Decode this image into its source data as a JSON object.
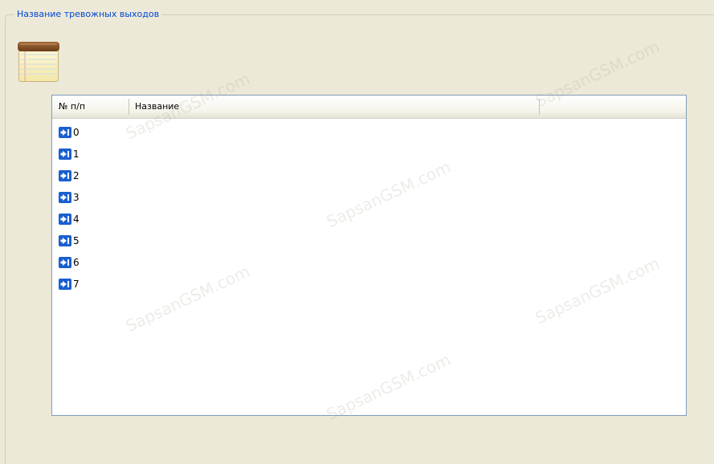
{
  "groupbox": {
    "title": "Название тревожных выходов",
    "icon": "notepad-icon"
  },
  "listview": {
    "columns": [
      "№ п/п",
      "Название",
      ""
    ],
    "rows": [
      {
        "number": "0",
        "name": "",
        "icon": "output-arrow-icon"
      },
      {
        "number": "1",
        "name": "",
        "icon": "output-arrow-icon"
      },
      {
        "number": "2",
        "name": "",
        "icon": "output-arrow-icon"
      },
      {
        "number": "3",
        "name": "",
        "icon": "output-arrow-icon"
      },
      {
        "number": "4",
        "name": "",
        "icon": "output-arrow-icon"
      },
      {
        "number": "5",
        "name": "",
        "icon": "output-arrow-icon"
      },
      {
        "number": "6",
        "name": "",
        "icon": "output-arrow-icon"
      },
      {
        "number": "7",
        "name": "",
        "icon": "output-arrow-icon"
      }
    ]
  },
  "colors": {
    "background": "#ECE9D8",
    "title": "#0046D5",
    "list_border": "#7F9DB9",
    "icon_blue": "#1A5FD0"
  },
  "watermark": "SapsanGSM.com"
}
